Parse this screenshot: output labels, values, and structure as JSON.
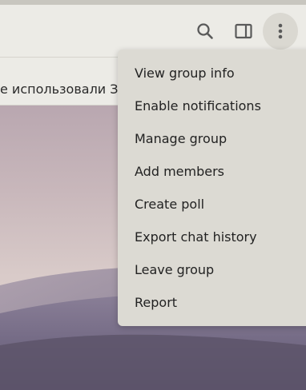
{
  "header": {
    "icons": [
      "search-icon",
      "sidebar-toggle-icon",
      "more-vertical-icon"
    ]
  },
  "pinned": {
    "text": "е использовали Зу"
  },
  "menu": {
    "items": [
      {
        "label": "View group info"
      },
      {
        "label": "Enable notifications"
      },
      {
        "label": "Manage group"
      },
      {
        "label": "Add members"
      },
      {
        "label": "Create poll"
      },
      {
        "label": "Export chat history"
      },
      {
        "label": "Leave group"
      },
      {
        "label": "Report"
      }
    ]
  },
  "colors": {
    "header_bg": "#ecebe6",
    "menu_bg": "#dcdad3",
    "icon": "#5a5a5a"
  }
}
